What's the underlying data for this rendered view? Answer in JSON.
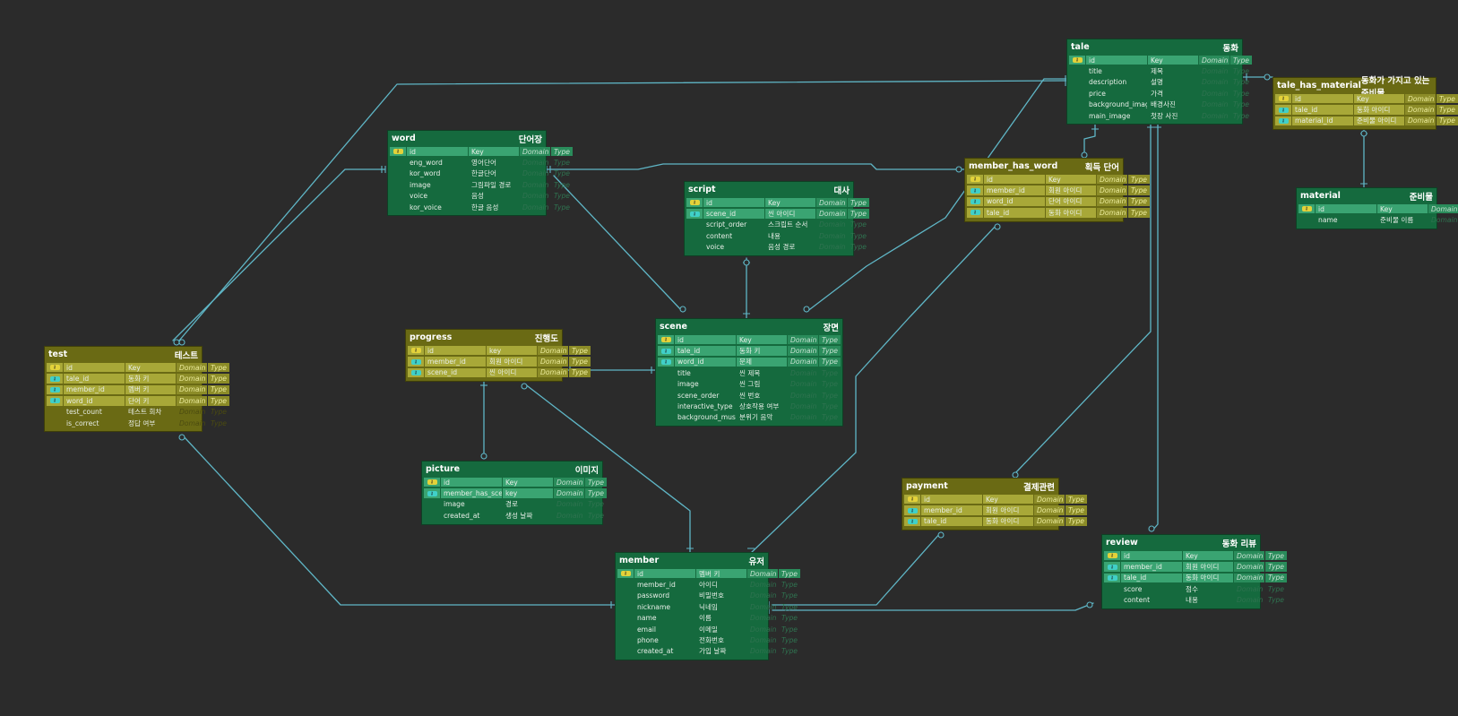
{
  "colors": {
    "background": "#2b2b2b",
    "entity_green": "#156a3e",
    "entity_olive": "#6a6a14",
    "relation_line": "#5fb6c6",
    "pk_badge": "#e3d23a",
    "fk_badge": "#40d0c8"
  },
  "entities": [
    {
      "id": "tale",
      "title": "tale",
      "label": "동화",
      "color": "green",
      "rows": [
        {
          "name": "id",
          "kind": "pk",
          "key": "Key",
          "domain": "Domain",
          "type": "Type"
        },
        {
          "name": "title",
          "kind": "attr",
          "key": "제목",
          "domain": "Domain",
          "type": "Type"
        },
        {
          "name": "description",
          "kind": "attr",
          "key": "설명",
          "domain": "Domain",
          "type": "Type"
        },
        {
          "name": "price",
          "kind": "attr",
          "key": "가격",
          "domain": "Domain",
          "type": "Type"
        },
        {
          "name": "background_image",
          "kind": "attr",
          "key": "배경사진",
          "domain": "Domain",
          "type": "Type"
        },
        {
          "name": "main_image",
          "kind": "attr",
          "key": "첫장 사진",
          "domain": "Domain",
          "type": "Type"
        }
      ]
    },
    {
      "id": "tale_has_material",
      "title": "tale_has_material",
      "label": "동화가 가지고 있는 준비물",
      "color": "olive",
      "rows": [
        {
          "name": "id",
          "kind": "pk",
          "key": "Key",
          "domain": "Domain",
          "type": "Type"
        },
        {
          "name": "tale_id",
          "kind": "fk",
          "key": "동화 아이디",
          "domain": "Domain",
          "type": "Type"
        },
        {
          "name": "material_id",
          "kind": "fk",
          "key": "준비물 아이디",
          "domain": "Domain",
          "type": "Type"
        }
      ]
    },
    {
      "id": "material",
      "title": "material",
      "label": "준비물",
      "color": "green",
      "rows": [
        {
          "name": "id",
          "kind": "pk",
          "key": "Key",
          "domain": "Domain",
          "type": "Type"
        },
        {
          "name": "name",
          "kind": "attr",
          "key": "준비물 이름",
          "domain": "Domain",
          "type": "Type"
        }
      ]
    },
    {
      "id": "word",
      "title": "word",
      "label": "단어장",
      "color": "green",
      "rows": [
        {
          "name": "id",
          "kind": "pk",
          "key": "Key",
          "domain": "Domain",
          "type": "Type"
        },
        {
          "name": "eng_word",
          "kind": "attr",
          "key": "영어단어",
          "domain": "Domain",
          "type": "Type"
        },
        {
          "name": "kor_word",
          "kind": "attr",
          "key": "한글단어",
          "domain": "Domain",
          "type": "Type"
        },
        {
          "name": "image",
          "kind": "attr",
          "key": "그림파일 경로",
          "domain": "Domain",
          "type": "Type"
        },
        {
          "name": "voice",
          "kind": "attr",
          "key": "음성",
          "domain": "Domain",
          "type": "Type"
        },
        {
          "name": "kor_voice",
          "kind": "attr",
          "key": "한글 음성",
          "domain": "Domain",
          "type": "Type"
        }
      ]
    },
    {
      "id": "member_has_word",
      "title": "member_has_word",
      "label": "획득 단어",
      "color": "olive",
      "rows": [
        {
          "name": "id",
          "kind": "pk",
          "key": "Key",
          "domain": "Domain",
          "type": "Type"
        },
        {
          "name": "member_id",
          "kind": "fk",
          "key": "회원 아이디",
          "domain": "Domain",
          "type": "Type"
        },
        {
          "name": "word_id",
          "kind": "fk",
          "key": "단어 아이디",
          "domain": "Domain",
          "type": "Type"
        },
        {
          "name": "tale_id",
          "kind": "fk",
          "key": "동화 아이디",
          "domain": "Domain",
          "type": "Type"
        }
      ]
    },
    {
      "id": "script",
      "title": "script",
      "label": "대사",
      "color": "green",
      "rows": [
        {
          "name": "id",
          "kind": "pk",
          "key": "Key",
          "domain": "Domain",
          "type": "Type"
        },
        {
          "name": "scene_id",
          "kind": "fk",
          "key": "씬 아이디",
          "domain": "Domain",
          "type": "Type"
        },
        {
          "name": "script_order",
          "kind": "attr",
          "key": "스크립트 순서",
          "domain": "Domain",
          "type": "Type"
        },
        {
          "name": "content",
          "kind": "attr",
          "key": "내용",
          "domain": "Domain",
          "type": "Type"
        },
        {
          "name": "voice",
          "kind": "attr",
          "key": "음성 경로",
          "domain": "Domain",
          "type": "Type"
        }
      ]
    },
    {
      "id": "progress",
      "title": "progress",
      "label": "진행도",
      "color": "olive",
      "rows": [
        {
          "name": "id",
          "kind": "pk",
          "key": "key",
          "domain": "Domain",
          "type": "Type"
        },
        {
          "name": "member_id",
          "kind": "fk",
          "key": "회원 아이디",
          "domain": "Domain",
          "type": "Type"
        },
        {
          "name": "scene_id",
          "kind": "fk",
          "key": "씬 아이디",
          "domain": "Domain",
          "type": "Type"
        }
      ]
    },
    {
      "id": "scene",
      "title": "scene",
      "label": "장면",
      "color": "green",
      "rows": [
        {
          "name": "id",
          "kind": "pk",
          "key": "Key",
          "domain": "Domain",
          "type": "Type"
        },
        {
          "name": "tale_id",
          "kind": "fk",
          "key": "동화 키",
          "domain": "Domain",
          "type": "Type"
        },
        {
          "name": "word_id",
          "kind": "fk",
          "key": "문제",
          "domain": "Domain",
          "type": "Type"
        },
        {
          "name": "title",
          "kind": "attr",
          "key": "씬 제목",
          "domain": "Domain",
          "type": "Type"
        },
        {
          "name": "image",
          "kind": "attr",
          "key": "씬 그림",
          "domain": "Domain",
          "type": "Type"
        },
        {
          "name": "scene_order",
          "kind": "attr",
          "key": "씬 번호",
          "domain": "Domain",
          "type": "Type"
        },
        {
          "name": "interactive_type",
          "kind": "attr",
          "key": "상호작용 여부",
          "domain": "Domain",
          "type": "Type"
        },
        {
          "name": "background_music",
          "kind": "attr",
          "key": "분위기 음악",
          "domain": "Domain",
          "type": "Type"
        }
      ]
    },
    {
      "id": "test",
      "title": "test",
      "label": "테스트",
      "color": "olive",
      "rows": [
        {
          "name": "id",
          "kind": "pk",
          "key": "Key",
          "domain": "Domain",
          "type": "Type"
        },
        {
          "name": "tale_id",
          "kind": "fk",
          "key": "동화 키",
          "domain": "Domain",
          "type": "Type"
        },
        {
          "name": "member_id",
          "kind": "fk",
          "key": "멤버 키",
          "domain": "Domain",
          "type": "Type"
        },
        {
          "name": "word_id",
          "kind": "fk",
          "key": "단어 키",
          "domain": "Domain",
          "type": "Type"
        },
        {
          "name": "test_count",
          "kind": "attr",
          "key": "테스트 회차",
          "domain": "Domain",
          "type": "Type"
        },
        {
          "name": "is_correct",
          "kind": "attr",
          "key": "정답 여부",
          "domain": "Domain",
          "type": "Type"
        }
      ]
    },
    {
      "id": "picture",
      "title": "picture",
      "label": "이미지",
      "color": "green",
      "rows": [
        {
          "name": "id",
          "kind": "pk",
          "key": "Key",
          "domain": "Domain",
          "type": "Type"
        },
        {
          "name": "member_has_scene_id",
          "kind": "fk",
          "key": "key",
          "domain": "Domain",
          "type": "Type"
        },
        {
          "name": "image",
          "kind": "attr",
          "key": "경로",
          "domain": "Domain",
          "type": "Type"
        },
        {
          "name": "created_at",
          "kind": "attr",
          "key": "생성 날짜",
          "domain": "Domain",
          "type": "Type"
        }
      ]
    },
    {
      "id": "payment",
      "title": "payment",
      "label": "결제관련",
      "color": "olive",
      "rows": [
        {
          "name": "id",
          "kind": "pk",
          "key": "Key",
          "domain": "Domain",
          "type": "Type"
        },
        {
          "name": "member_id",
          "kind": "fk",
          "key": "회원 아이디",
          "domain": "Domain",
          "type": "Type"
        },
        {
          "name": "tale_id",
          "kind": "fk",
          "key": "동화 아이디",
          "domain": "Domain",
          "type": "Type"
        }
      ]
    },
    {
      "id": "review",
      "title": "review",
      "label": "동화 리뷰",
      "color": "green",
      "rows": [
        {
          "name": "id",
          "kind": "pk",
          "key": "Key",
          "domain": "Domain",
          "type": "Type"
        },
        {
          "name": "member_id",
          "kind": "fk",
          "key": "회원 아이디",
          "domain": "Domain",
          "type": "Type"
        },
        {
          "name": "tale_id",
          "kind": "fk",
          "key": "동화 아이디",
          "domain": "Domain",
          "type": "Type"
        },
        {
          "name": "score",
          "kind": "attr",
          "key": "점수",
          "domain": "Domain",
          "type": "Type"
        },
        {
          "name": "content",
          "kind": "attr",
          "key": "내용",
          "domain": "Domain",
          "type": "Type"
        }
      ]
    },
    {
      "id": "member",
      "title": "member",
      "label": "유저",
      "color": "green",
      "rows": [
        {
          "name": "id",
          "kind": "pk",
          "key": "멤버 키",
          "domain": "Domain",
          "type": "Type"
        },
        {
          "name": "member_id",
          "kind": "attr",
          "key": "아이디",
          "domain": "Domain",
          "type": "Type"
        },
        {
          "name": "password",
          "kind": "attr",
          "key": "비밀번호",
          "domain": "Domain",
          "type": "Type"
        },
        {
          "name": "nickname",
          "kind": "attr",
          "key": "닉네임",
          "domain": "Domain",
          "type": "Type"
        },
        {
          "name": "name",
          "kind": "attr",
          "key": "이름",
          "domain": "Domain",
          "type": "Type"
        },
        {
          "name": "email",
          "kind": "attr",
          "key": "이메일",
          "domain": "Domain",
          "type": "Type"
        },
        {
          "name": "phone",
          "kind": "attr",
          "key": "전화번호",
          "domain": "Domain",
          "type": "Type"
        },
        {
          "name": "created_at",
          "kind": "attr",
          "key": "가입 날짜",
          "domain": "Domain",
          "type": "Type"
        }
      ]
    }
  ]
}
